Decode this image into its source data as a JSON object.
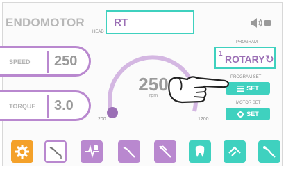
{
  "header": {
    "title": "ENDOMOTOR",
    "head_label": "HEAD",
    "head_value": "RT",
    "speaker_icon": "volume-icon"
  },
  "speed": {
    "label": "SPEED",
    "value": "250"
  },
  "torque": {
    "label": "TORQUE",
    "value": "3.0"
  },
  "gauge": {
    "value": "250",
    "unit": "rpm",
    "min": "200",
    "max": "1200",
    "level": 0.05
  },
  "program": {
    "label": "PROGRAM",
    "number": "1",
    "name": "ROTARY",
    "cycle_icon": "rotate-icon"
  },
  "program_set": {
    "label": "PROGRAM SET",
    "button": "SET",
    "icon": "list-icon"
  },
  "motor_set": {
    "label": "MOTOR SET",
    "button": "SET",
    "icon": "gear-icon"
  },
  "colors": {
    "accent": "#3fd1bf",
    "purple": "#b988cf",
    "orange": "#f4a12a"
  },
  "toolbar": [
    {
      "icon": "settings-gear-icon",
      "style": "orange"
    },
    {
      "icon": "handpiece-icon",
      "style": "outline"
    },
    {
      "icon": "apex-locator-icon",
      "style": "purple"
    },
    {
      "icon": "file-purple-icon",
      "style": "purple"
    },
    {
      "icon": "tweezers-purple-icon",
      "style": "purple"
    },
    {
      "icon": "tooth-icon",
      "style": "teal"
    },
    {
      "icon": "file-teal-icon",
      "style": "teal"
    },
    {
      "icon": "handpiece-teal-icon",
      "style": "teal"
    }
  ]
}
